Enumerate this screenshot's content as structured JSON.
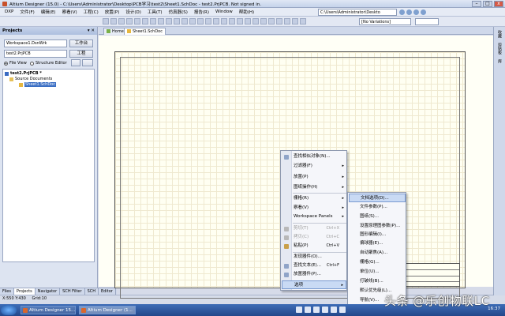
{
  "window": {
    "title": "Altium Designer (15.0) - C:\\Users\\Administrator\\Desktop\\PCB学习\\test2\\Sheet1.SchDoc - test2.PrjPCB. Not signed in.",
    "buttons": {
      "minimize": "–",
      "maximize": "□",
      "close": "x"
    }
  },
  "menu": {
    "items": [
      "DXP",
      "文件(F)",
      "编辑(E)",
      "察看(V)",
      "工程(C)",
      "放置(P)",
      "设计(D)",
      "工具(T)",
      "仿真器(S)",
      "报告(R)",
      "Window",
      "帮助(H)"
    ],
    "path": "C:\\Users\\Administrator\\Deskto"
  },
  "toolbar": {
    "variant": "[No Variations]"
  },
  "projects_panel": {
    "header": "Projects",
    "pin": "▾ ✕",
    "workspace_value": "Workspace1.DsnWrk",
    "workspace_button": "工作台",
    "project_value": "test2.PrjPCB",
    "project_button": "工程",
    "file_view": "File View",
    "structure_editor": "Structure Editor",
    "tree": {
      "project": "test2.PrjPCB *",
      "folder": "Source Documents",
      "file": "Sheet1.SchDoc"
    }
  },
  "bottom_tabs": [
    "Files",
    "Projects",
    "Navigator",
    "SCH Filter",
    "SCH",
    "Editor"
  ],
  "status": {
    "coords": "X:550 Y:430",
    "grid": "Grid:10"
  },
  "doc_tabs": {
    "home": "Home",
    "sheet": "Sheet1.SchDoc"
  },
  "right_strip": [
    "收藏",
    "剪贴板",
    "库"
  ],
  "context_menu": {
    "items": [
      {
        "label": "查找相似对象(N)...",
        "shortcut": "",
        "arrow": "",
        "disabled": false
      },
      {
        "label": "过滤器(F)",
        "shortcut": "",
        "arrow": "▸",
        "disabled": false
      },
      {
        "label": "放置(P)",
        "shortcut": "",
        "arrow": "▸",
        "disabled": false
      },
      {
        "label": "图纸操作(H)",
        "shortcut": "",
        "arrow": "▸",
        "disabled": false
      },
      {
        "label": "栅格(R)",
        "shortcut": "",
        "arrow": "▸",
        "disabled": false
      },
      {
        "label": "察看(V)",
        "shortcut": "",
        "arrow": "▸",
        "disabled": false
      },
      {
        "label": "Workspace Panels",
        "shortcut": "",
        "arrow": "▸",
        "disabled": false
      },
      {
        "label": "剪切(T)",
        "shortcut": "Ctrl+X",
        "arrow": "",
        "disabled": true
      },
      {
        "label": "拷贝(C)",
        "shortcut": "Ctrl+C",
        "arrow": "",
        "disabled": true
      },
      {
        "label": "粘贴(P)",
        "shortcut": "Ctrl+V",
        "arrow": "",
        "disabled": false
      },
      {
        "label": "发现器件(O)...",
        "shortcut": "",
        "arrow": "",
        "disabled": false
      },
      {
        "label": "查找文本(E)...",
        "shortcut": "Ctrl+F",
        "arrow": "",
        "disabled": false
      },
      {
        "label": "放置器件(P)...",
        "shortcut": "",
        "arrow": "",
        "disabled": false
      },
      {
        "label": "选项",
        "shortcut": "",
        "arrow": "▸",
        "disabled": false
      }
    ]
  },
  "submenu": {
    "items": [
      "文档选项(D)...",
      "文件参数(P)...",
      "图纸(S)...",
      "设置原理图参数(P)...",
      "图形编辑(I)...",
      "偏球器(E)...",
      "自动聚焦(A)...",
      "栅格(G)...",
      "单位(U)...",
      "打破线(B)...",
      "默认优先级(L)...",
      "导航(V)..."
    ]
  },
  "taskbar": {
    "tasks": [
      "Altium Designer 15...",
      "Altium Designer (1..."
    ],
    "clock": "16:37"
  },
  "watermark": "头条 @乐创物联LC"
}
